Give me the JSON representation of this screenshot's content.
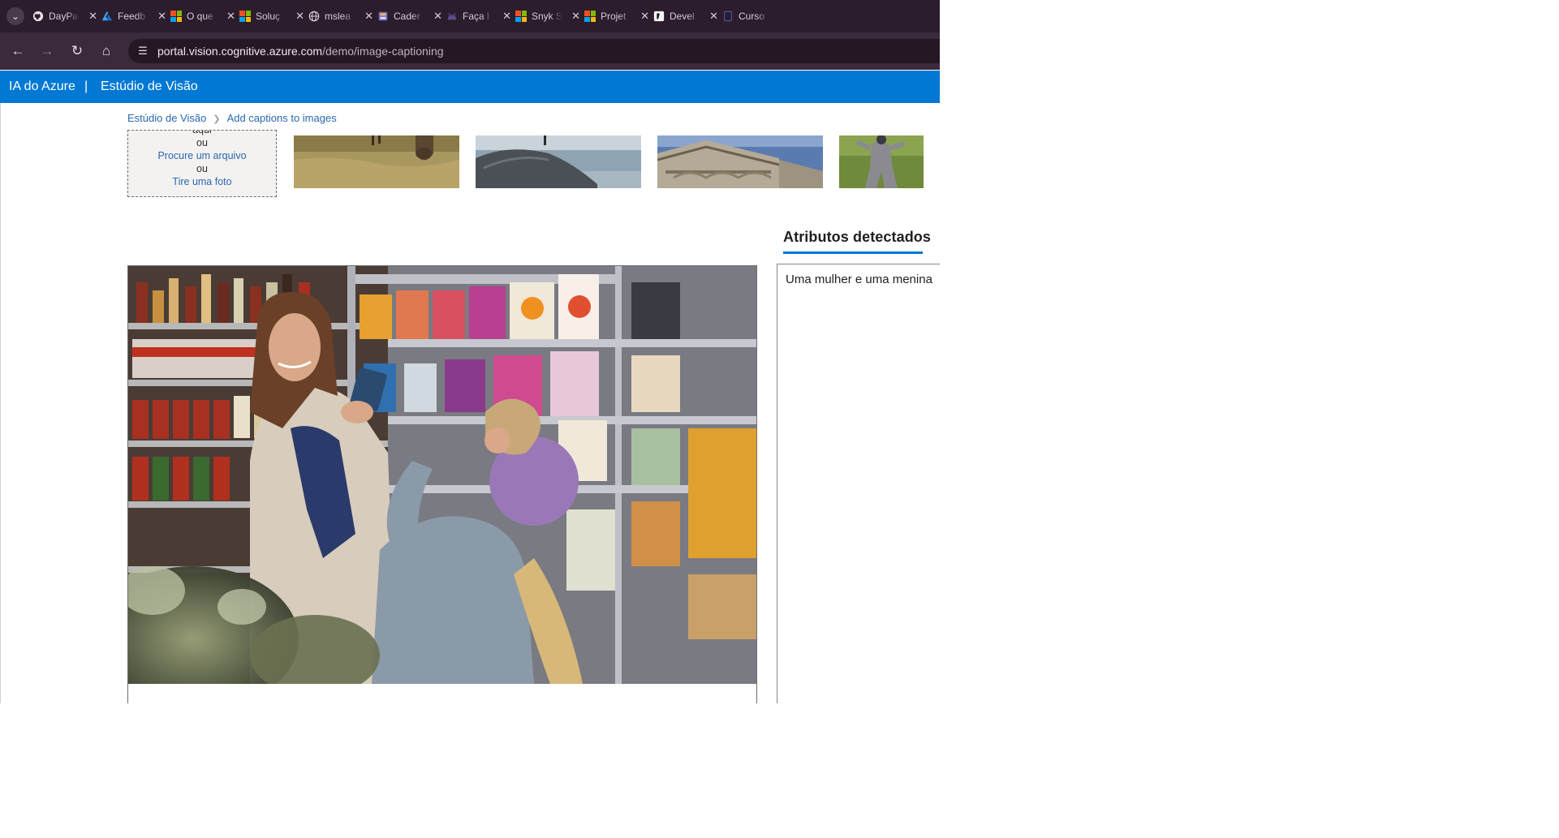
{
  "browser": {
    "tabs": [
      {
        "icon": "github-icon",
        "label": "DayPa"
      },
      {
        "icon": "azure-devops-icon",
        "label": "Feedb"
      },
      {
        "icon": "microsoft-logo-icon",
        "label": "O que"
      },
      {
        "icon": "microsoft-logo-icon",
        "label": "Soluç"
      },
      {
        "icon": "globe-icon",
        "label": "mslea"
      },
      {
        "icon": "notebook-icon",
        "label": "Cader"
      },
      {
        "icon": "cat-icon",
        "label": "Faça l"
      },
      {
        "icon": "microsoft-logo-icon",
        "label": "Snyk S"
      },
      {
        "icon": "microsoft-logo-icon",
        "label": "Projet"
      },
      {
        "icon": "dev-icon",
        "label": "Devel"
      },
      {
        "icon": "document-icon",
        "label": "Curso"
      }
    ],
    "url_host": "portal.vision.cognitive.azure.com",
    "url_path": "/demo/image-captioning"
  },
  "header": {
    "brand": "IA do Azure",
    "separator": "|",
    "product": "Estúdio de Visão"
  },
  "breadcrumb": {
    "root": "Estúdio de Visão",
    "current": "Add captions to images"
  },
  "upload": {
    "partial_top": "aqui",
    "or_1": "ou",
    "browse_link": "Procure um arquivo",
    "or_2": "ou",
    "camera_link": "Tire uma foto"
  },
  "results": {
    "tab_label": "Atributos detectados",
    "caption_text": "Uma mulher e uma menina"
  },
  "colors": {
    "azure_blue": "#0078d4",
    "link_blue": "#2b67b0",
    "tab_strip": "#2b1d2c",
    "nav_bar": "#3a2a3b"
  }
}
